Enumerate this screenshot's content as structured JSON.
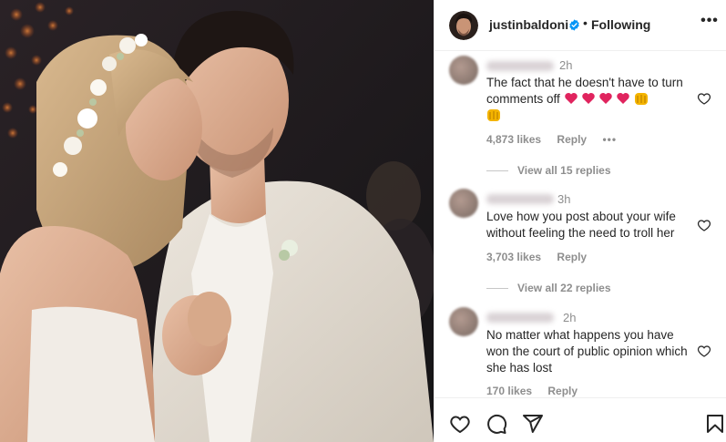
{
  "post": {
    "photo_alt": "Photo of a couple at a wedding, bride wearing a flower crown kissing groom's cheek"
  },
  "header": {
    "username": "justinbaldoni",
    "separator": "•",
    "follow_status": "Following",
    "more_icon": "more-horizontal-icon",
    "verified_color": "#0095f6"
  },
  "comments": [
    {
      "time": "2h",
      "text": "The fact that he doesn't have to turn comments off",
      "likes": "4,873 likes",
      "reply": "Reply",
      "more": "•••",
      "view_replies": "View all 15 replies"
    },
    {
      "time": "3h",
      "text": "Love how you post about your wife without feeling the need to troll her",
      "likes": "3,703 likes",
      "reply": "Reply",
      "view_replies": "View all 22 replies"
    },
    {
      "time": "2h",
      "text": "No matter what happens you have won the court of public opinion which she has lost",
      "likes": "170 likes",
      "reply": "Reply"
    }
  ],
  "actions": {
    "like_icon": "heart-outline-icon",
    "comment_icon": "comment-icon",
    "share_icon": "share-icon",
    "save_icon": "bookmark-icon"
  },
  "colors": {
    "text": "#262626",
    "secondary_text": "#8e8e8e",
    "heart_red": "#e0245e",
    "border": "#efefef"
  }
}
